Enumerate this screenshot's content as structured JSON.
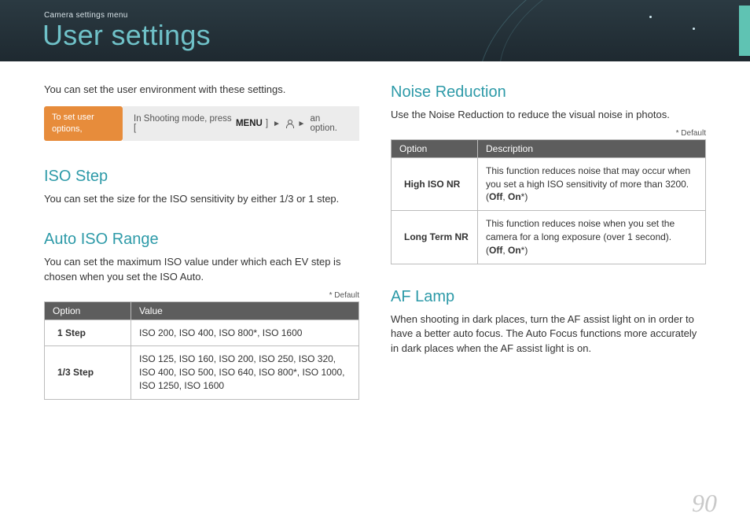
{
  "header": {
    "breadcrumb": "Camera settings menu",
    "title": "User settings"
  },
  "intro": "You can set the user environment with these settings.",
  "instruction": {
    "badge": "To set user options,",
    "prefix": "In Shooting mode, press [",
    "menu": "MENU",
    "mid": "] ",
    "suffix": " an option."
  },
  "iso_step": {
    "heading": "ISO Step",
    "desc": "You can set the size for the ISO sensitivity by either 1/3 or 1 step."
  },
  "auto_iso": {
    "heading": "Auto ISO Range",
    "desc": "You can set the maximum ISO value under which each EV step is chosen when you set the ISO Auto.",
    "default_note": "* Default",
    "headers": [
      "Option",
      "Value"
    ],
    "rows": [
      {
        "option": "1 Step",
        "value": "ISO 200, ISO 400, ISO 800*, ISO 1600"
      },
      {
        "option": "1/3 Step",
        "value": "ISO 125, ISO 160, ISO 200, ISO 250, ISO 320, ISO 400, ISO 500, ISO 640, ISO 800*, ISO 1000, ISO 1250, ISO 1600"
      }
    ]
  },
  "noise": {
    "heading": "Noise Reduction",
    "desc": "Use the Noise Reduction to reduce the visual noise in photos.",
    "default_note": "* Default",
    "headers": [
      "Option",
      "Description"
    ],
    "rows": [
      {
        "option": "High ISO NR",
        "desc_line": "This function reduces noise that may occur when you set a high ISO sensitivity of more than 3200.",
        "opts_prefix": "(",
        "off": "Off",
        "sep": ", ",
        "on": "On",
        "star_suffix": "*)"
      },
      {
        "option": "Long Term NR",
        "desc_line": "This function reduces noise when you set the camera for a long exposure (over 1 second).",
        "opts_prefix": "(",
        "off": "Off",
        "sep": ", ",
        "on": "On",
        "star_suffix": "*)"
      }
    ]
  },
  "af_lamp": {
    "heading": "AF Lamp",
    "desc": "When shooting in dark places, turn the AF assist light on in order to have a better auto focus. The Auto Focus functions more accurately in dark places when the AF assist light is on."
  },
  "page_number": "90"
}
